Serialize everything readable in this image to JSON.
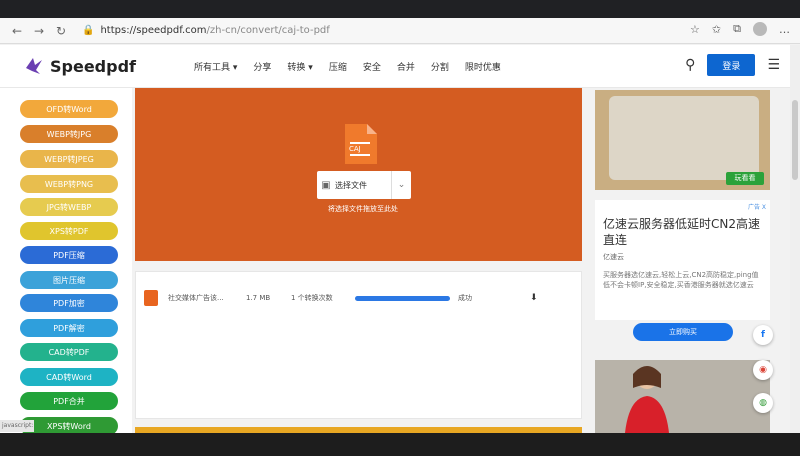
{
  "browser": {
    "url_host": "https://speedpdf.com",
    "url_path": "/zh-cn/convert/caj-to-pdf"
  },
  "header": {
    "brand": "Speedpdf",
    "menu": [
      "所有工具",
      "分享",
      "转换",
      "压缩",
      "安全",
      "合并",
      "分割",
      "限时优惠"
    ],
    "login_label": "登录"
  },
  "sidebar": {
    "items": [
      {
        "label": "OFD转Word",
        "color": "#f2a83b"
      },
      {
        "label": "WEBP转JPG",
        "color": "#d97f2b"
      },
      {
        "label": "WEBP转JPEG",
        "color": "#e9b54a"
      },
      {
        "label": "WEBP转PNG",
        "color": "#e8be4e"
      },
      {
        "label": "JPG转WEBP",
        "color": "#e6cb4f"
      },
      {
        "label": "XPS转PDF",
        "color": "#e0c52d"
      },
      {
        "label": "PDF压缩",
        "color": "#2b6bd6"
      },
      {
        "label": "图片压缩",
        "color": "#3ba2d9"
      },
      {
        "label": "PDF加密",
        "color": "#2f85da"
      },
      {
        "label": "PDF解密",
        "color": "#2f9fdc"
      },
      {
        "label": "CAD转PDF",
        "color": "#23b28d"
      },
      {
        "label": "CAD转Word",
        "color": "#1eb3c4"
      },
      {
        "label": "PDF合并",
        "color": "#22a33a"
      },
      {
        "label": "XPS转Word",
        "color": "#2f9a34"
      }
    ]
  },
  "upload": {
    "file_badge": "CAJ",
    "select_label": "选择文件",
    "drop_hint": "将选择文件拖放至此处"
  },
  "file_row": {
    "name": "社交媒体广告该...",
    "size": "1.7 MB",
    "pages": "1 个转换次数",
    "progress": 1.0,
    "status": "成功"
  },
  "ads": {
    "game_button": "玩看看",
    "ad_mark": "广告 X",
    "headline": "亿速云服务器低延时CN2高速直连",
    "brand": "亿速云",
    "desc": "买服务器选亿速云,轻松上云,CN2高防稳定,ping值低不会卡顿IP,安全稳定,买香港服务器就选亿速云",
    "cta": "立即购买"
  },
  "status_bar": "javascript:"
}
